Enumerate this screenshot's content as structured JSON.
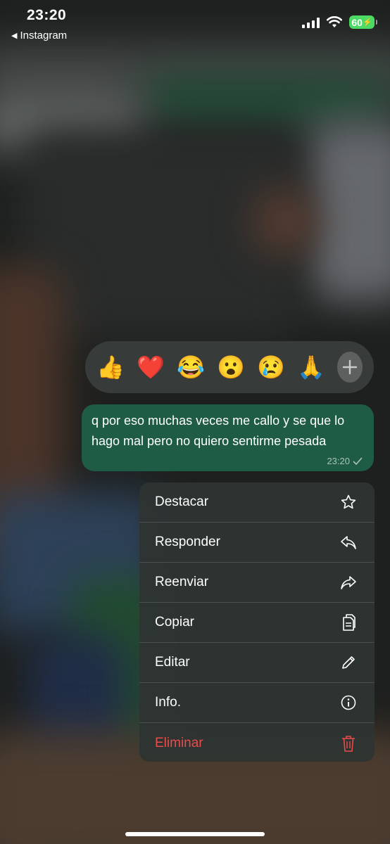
{
  "status_bar": {
    "time": "23:20",
    "back_label": "Instagram",
    "battery": "60"
  },
  "reactions": {
    "emojis": [
      {
        "name": "thumbs-up",
        "char": "👍"
      },
      {
        "name": "heart",
        "char": "❤️"
      },
      {
        "name": "tears-of-joy",
        "char": "😂"
      },
      {
        "name": "surprised",
        "char": "😮"
      },
      {
        "name": "crying",
        "char": "😢"
      },
      {
        "name": "praying",
        "char": "🙏"
      }
    ],
    "more_icon": "plus-icon"
  },
  "message": {
    "text": "q por eso muchas veces me callo y se que lo hago mal pero no quiero sentirme pesada",
    "time": "23:20",
    "status_icon": "check-icon"
  },
  "menu": {
    "items": [
      {
        "label": "Destacar",
        "icon": "star-icon"
      },
      {
        "label": "Responder",
        "icon": "reply-icon"
      },
      {
        "label": "Reenviar",
        "icon": "forward-icon"
      },
      {
        "label": "Copiar",
        "icon": "copy-icon"
      },
      {
        "label": "Editar",
        "icon": "pencil-icon"
      },
      {
        "label": "Info.",
        "icon": "info-icon"
      },
      {
        "label": "Eliminar",
        "icon": "trash-icon"
      }
    ]
  },
  "colors": {
    "bubble": "#1f5c45",
    "danger": "#ea4b4b",
    "battery": "#4cd964"
  }
}
